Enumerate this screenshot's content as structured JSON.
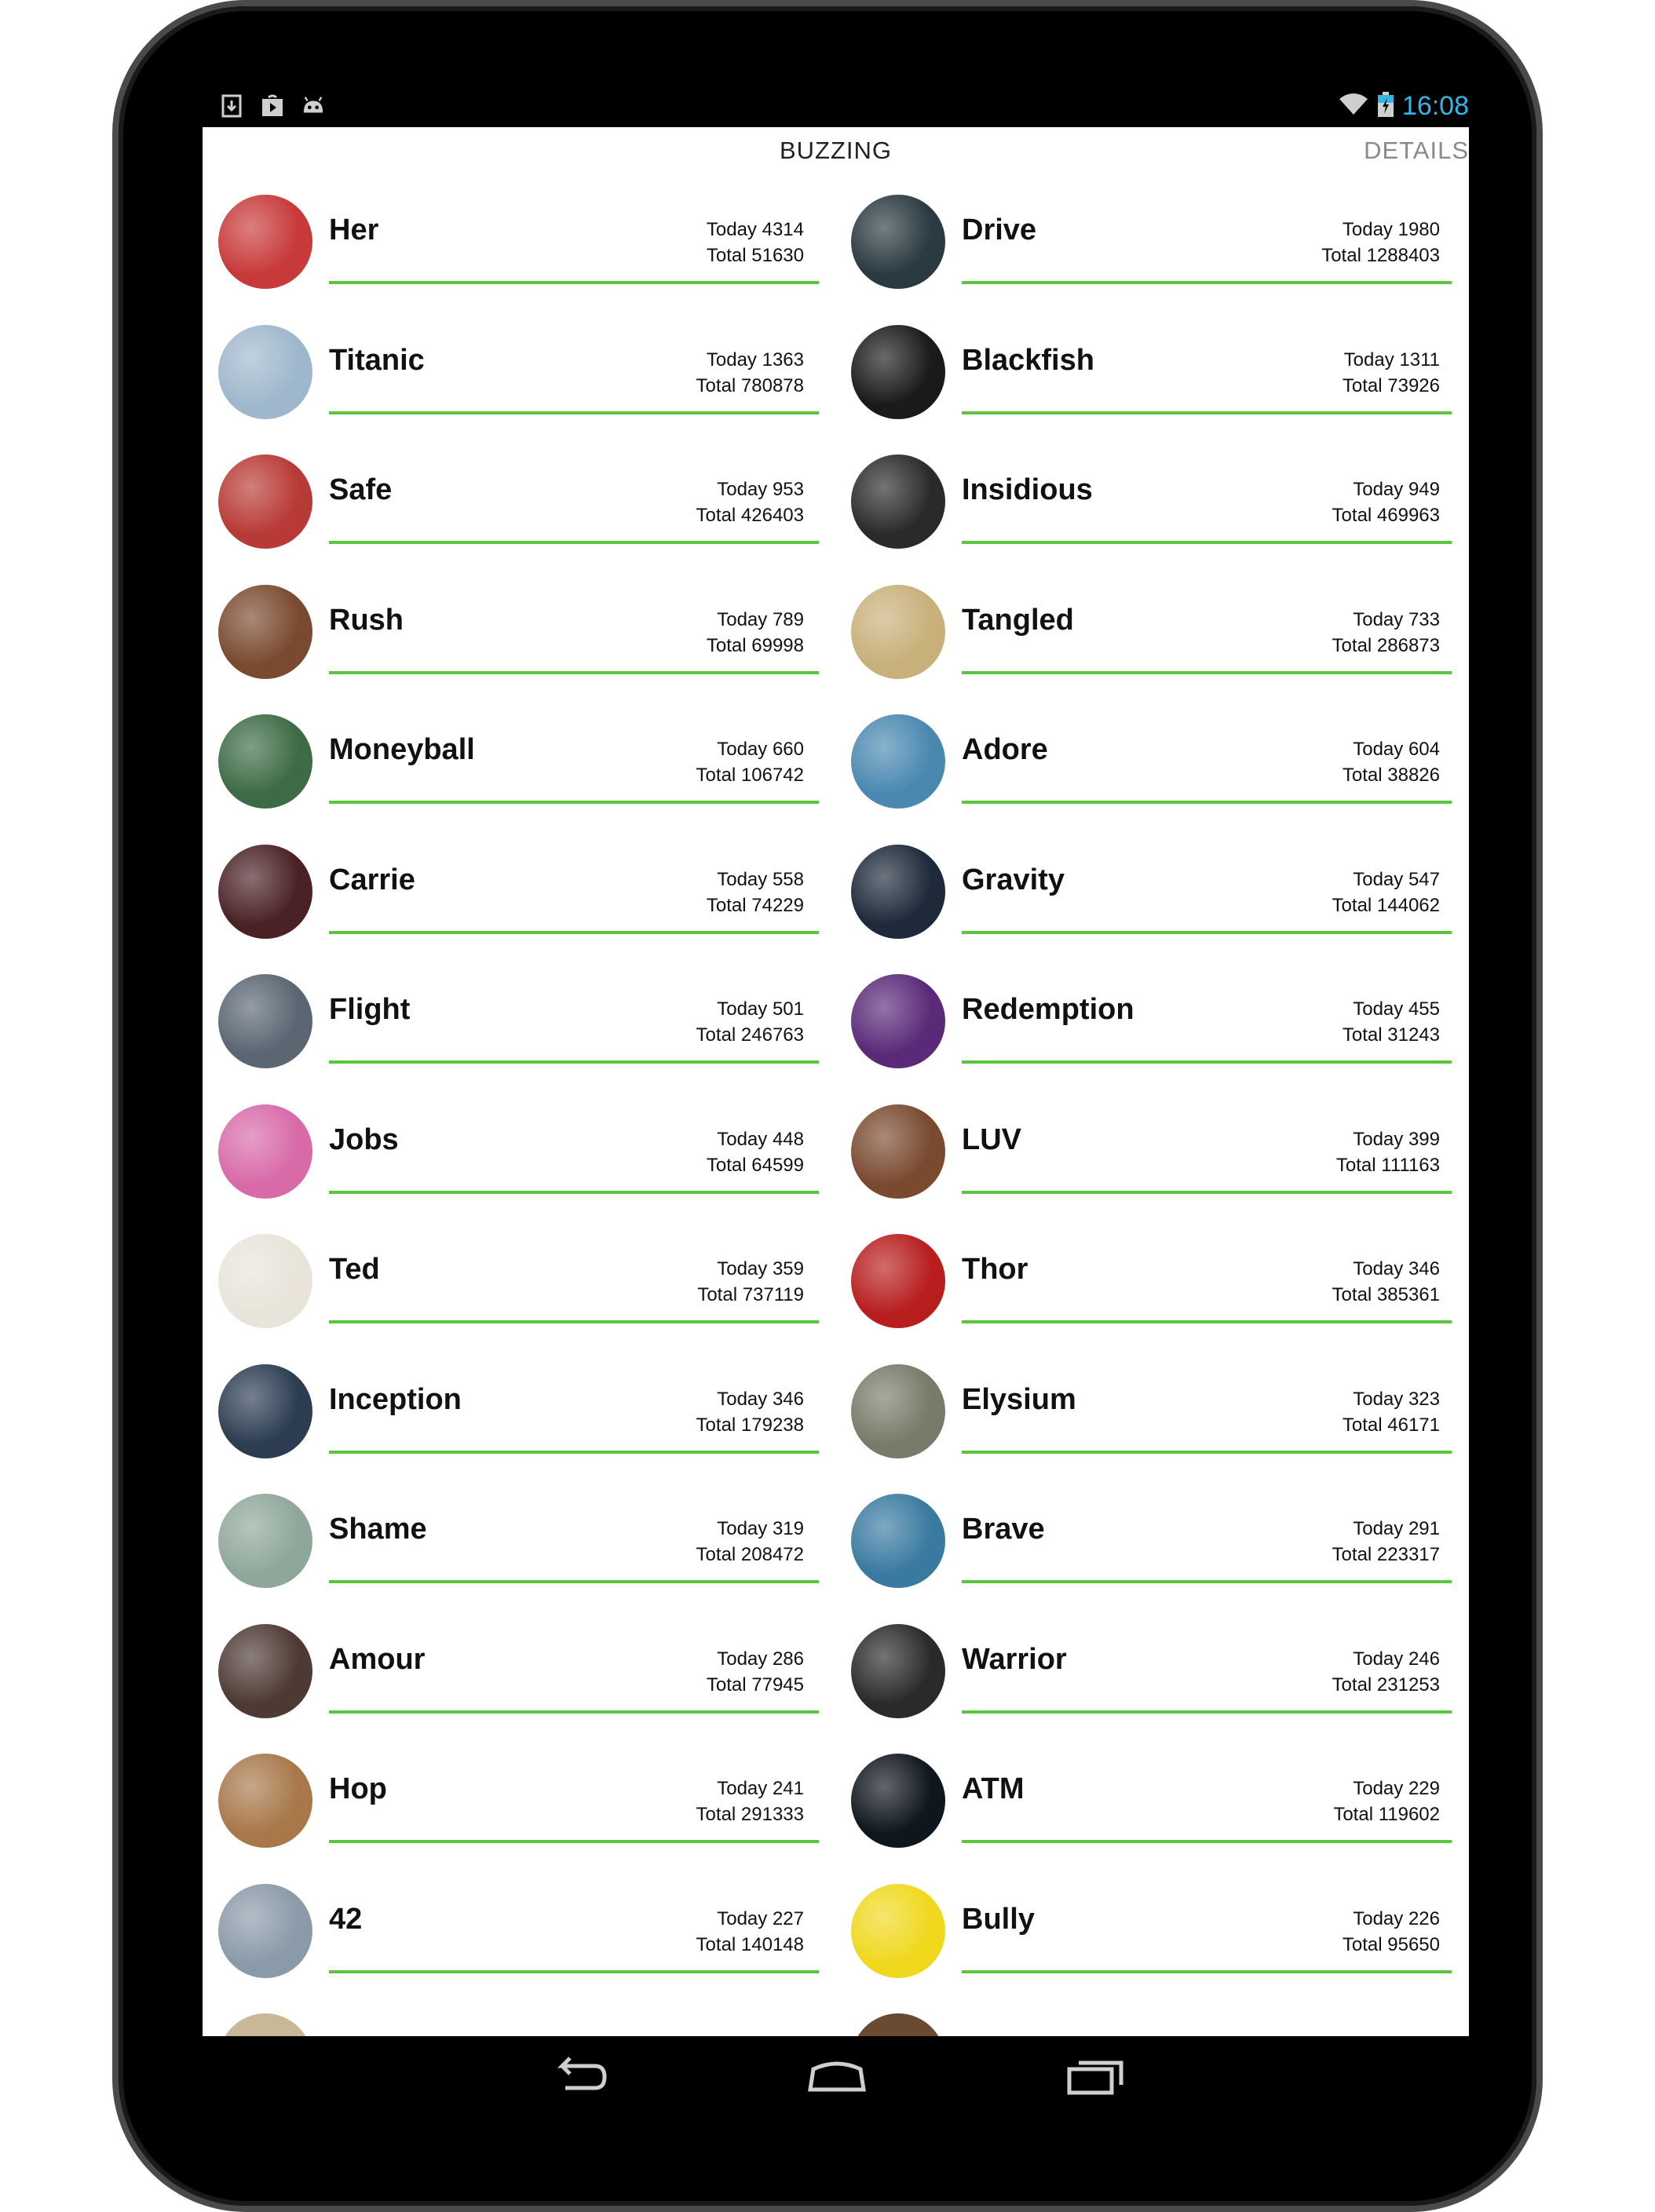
{
  "status_bar": {
    "time": "16:08",
    "icons_left": [
      "download-icon",
      "play-store-icon",
      "android-icon"
    ],
    "icons_right": [
      "wifi-icon",
      "battery-charging-icon"
    ],
    "accent": "#35b5e5"
  },
  "tabs": {
    "buzzing": "BUZZING",
    "details": "DETAILS"
  },
  "theme": {
    "divider_color": "#5cc53f"
  },
  "movies_left": [
    {
      "title": "Her",
      "today": "Today 4314",
      "total": "Total 51630",
      "poster_color": "#c83a3a"
    },
    {
      "title": "Titanic",
      "today": "Today 1363",
      "total": "Total 780878",
      "poster_color": "#9fb7cc"
    },
    {
      "title": "Safe",
      "today": "Today 953",
      "total": "Total 426403",
      "poster_color": "#b83a36"
    },
    {
      "title": "Rush",
      "today": "Today 789",
      "total": "Total 69998",
      "poster_color": "#7a4a30"
    },
    {
      "title": "Moneyball",
      "today": "Today 660",
      "total": "Total 106742",
      "poster_color": "#3d6b45"
    },
    {
      "title": "Carrie",
      "today": "Today 558",
      "total": "Total 74229",
      "poster_color": "#4a2226"
    },
    {
      "title": "Flight",
      "today": "Today 501",
      "total": "Total 246763",
      "poster_color": "#5a6672"
    },
    {
      "title": "Jobs",
      "today": "Today 448",
      "total": "Total 64599",
      "poster_color": "#d86aa8"
    },
    {
      "title": "Ted",
      "today": "Today 359",
      "total": "Total 737119",
      "poster_color": "#e8e4da"
    },
    {
      "title": "Inception",
      "today": "Today 346",
      "total": "Total 179238",
      "poster_color": "#2c3d52"
    },
    {
      "title": "Shame",
      "today": "Today 319",
      "total": "Total 208472",
      "poster_color": "#8fa79a"
    },
    {
      "title": "Amour",
      "today": "Today 286",
      "total": "Total 77945",
      "poster_color": "#4e3a34"
    },
    {
      "title": "Hop",
      "today": "Today 241",
      "total": "Total 291333",
      "poster_color": "#a8784a"
    },
    {
      "title": "42",
      "today": "Today 227",
      "total": "Total 140148",
      "poster_color": "#8a9aa8"
    }
  ],
  "movies_right": [
    {
      "title": "Drive",
      "today": "Today 1980",
      "total": "Total 1288403",
      "poster_color": "#2a3a40"
    },
    {
      "title": "Blackfish",
      "today": "Today 1311",
      "total": "Total 73926",
      "poster_color": "#1a1a1a"
    },
    {
      "title": "Insidious",
      "today": "Today 949",
      "total": "Total 469963",
      "poster_color": "#2a2a2a"
    },
    {
      "title": "Tangled",
      "today": "Today 733",
      "total": "Total 286873",
      "poster_color": "#c8b07a"
    },
    {
      "title": "Adore",
      "today": "Today 604",
      "total": "Total 38826",
      "poster_color": "#4a88b0"
    },
    {
      "title": "Gravity",
      "today": "Today 547",
      "total": "Total 144062",
      "poster_color": "#1e2a3a"
    },
    {
      "title": "Redemption",
      "today": "Today 455",
      "total": "Total 31243",
      "poster_color": "#5a2a78"
    },
    {
      "title": "LUV",
      "today": "Today 399",
      "total": "Total 111163",
      "poster_color": "#7a4a30"
    },
    {
      "title": "Thor",
      "today": "Today 346",
      "total": "Total 385361",
      "poster_color": "#b81e1e"
    },
    {
      "title": "Elysium",
      "today": "Today 323",
      "total": "Total 46171",
      "poster_color": "#7a7a6a"
    },
    {
      "title": "Brave",
      "today": "Today 291",
      "total": "Total 223317",
      "poster_color": "#3a7aa0"
    },
    {
      "title": "Warrior",
      "today": "Today 246",
      "total": "Total 231253",
      "poster_color": "#2a2a2a"
    },
    {
      "title": "ATM",
      "today": "Today 229",
      "total": "Total 119602",
      "poster_color": "#10161e"
    },
    {
      "title": "Bully",
      "today": "Today 226",
      "total": "Total 95650",
      "poster_color": "#f0d81e"
    }
  ],
  "partial_row": {
    "left_poster_color": "#c8b898",
    "right_poster_color": "#6a4a30"
  },
  "nav_bar": {
    "icons": [
      "back-icon",
      "home-icon",
      "recents-icon"
    ]
  }
}
